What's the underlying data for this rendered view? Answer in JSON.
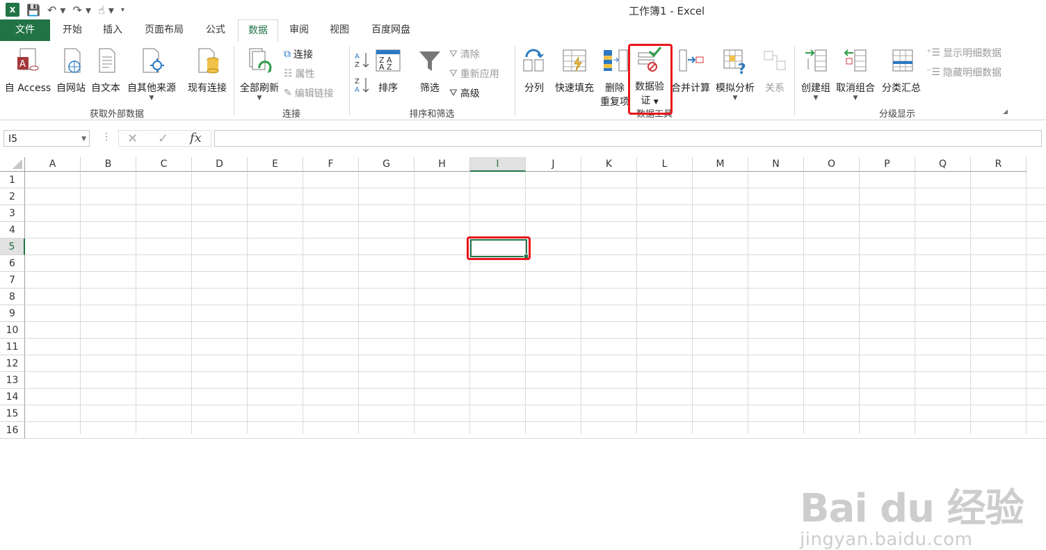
{
  "window": {
    "title": "工作簿1 - Excel",
    "app_logo": "X"
  },
  "quick_access": {
    "icons": [
      "save-icon",
      "undo-icon",
      "redo-icon",
      "touch-mode-icon",
      "customize-icon"
    ]
  },
  "tabs": [
    "文件",
    "开始",
    "插入",
    "页面布局",
    "公式",
    "数据",
    "审阅",
    "视图",
    "百度网盘"
  ],
  "active_tab": "数据",
  "ribbon": {
    "get_external": {
      "label": "获取外部数据",
      "access": "自 Access",
      "web": "自网站",
      "text": "自文本",
      "other": "自其他来源",
      "existing": "现有连接"
    },
    "connections": {
      "label": "连接",
      "refresh_all": "全部刷新",
      "connections": "连接",
      "properties": "属性",
      "edit_links": "编辑链接"
    },
    "sort_filter": {
      "label": "排序和筛选",
      "sort": "排序",
      "filter": "筛选",
      "clear": "清除",
      "reapply": "重新应用",
      "advanced": "高级"
    },
    "data_tools": {
      "label": "数据工具",
      "text_to_columns": "分列",
      "flash_fill": "快速填充",
      "remove_dup_1": "删除",
      "remove_dup_2": "重复项",
      "validation_1": "数据验",
      "validation_2": "证",
      "consolidate": "合并计算",
      "what_if": "模拟分析",
      "relationships": "关系"
    },
    "outline": {
      "label": "分级显示",
      "group": "创建组",
      "ungroup": "取消组合",
      "subtotal": "分类汇总",
      "show_detail": "显示明细数据",
      "hide_detail": "隐藏明细数据"
    }
  },
  "formula_bar": {
    "name_box": "I5",
    "fx": "fx",
    "value": ""
  },
  "sheet": {
    "columns": [
      "A",
      "B",
      "C",
      "D",
      "E",
      "F",
      "G",
      "H",
      "I",
      "J",
      "K",
      "L",
      "M",
      "N",
      "O",
      "P",
      "Q",
      "R"
    ],
    "rows": [
      "1",
      "2",
      "3",
      "4",
      "5",
      "6",
      "7",
      "8",
      "9",
      "10",
      "11",
      "12",
      "13",
      "14",
      "15",
      "16"
    ],
    "selected_column": "I",
    "selected_row": "5"
  },
  "watermark": {
    "main": "Bai du 经验",
    "sub": "jingyan.baidu.com"
  },
  "colors": {
    "excel_green": "#217346",
    "highlight_red": "#e8151b"
  }
}
